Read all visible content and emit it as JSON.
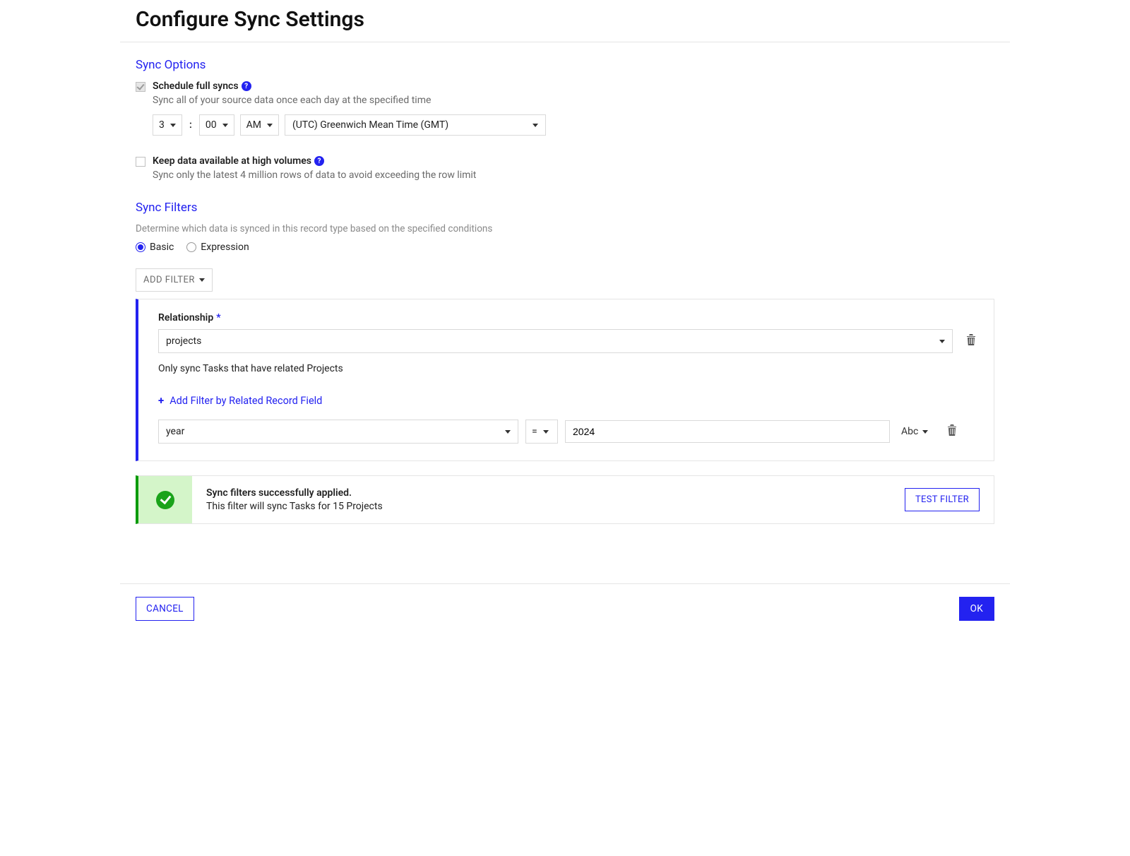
{
  "header": {
    "title": "Configure Sync Settings"
  },
  "sections": {
    "sync_options": {
      "title": "Sync Options",
      "schedule": {
        "label": "Schedule full syncs",
        "desc": "Sync all of your source data once each day at the specified time",
        "hour": "3",
        "minute": "00",
        "ampm": "AM",
        "timezone": "(UTC) Greenwich Mean Time (GMT)",
        "help": "?"
      },
      "high_volume": {
        "label": "Keep data available at high volumes",
        "desc": "Sync only the latest 4 million rows of data to avoid exceeding the row limit",
        "help": "?"
      }
    },
    "sync_filters": {
      "title": "Sync Filters",
      "desc": "Determine which data is synced in this record type based on the specified conditions",
      "radio": {
        "basic": "Basic",
        "expression": "Expression"
      },
      "add_filter": "ADD FILTER",
      "filter": {
        "relationship_label": "Relationship",
        "relationship_value": "projects",
        "explain": "Only sync Tasks that have related Projects",
        "add_related": "Add Filter by Related Record Field",
        "field_value": "year",
        "operator": "=",
        "value": "2024",
        "abc": "Abc"
      },
      "success": {
        "title": "Sync filters successfully applied.",
        "sub": "This filter will sync Tasks for 15 Projects",
        "test_btn": "TEST FILTER"
      }
    }
  },
  "footer": {
    "cancel": "CANCEL",
    "ok": "OK"
  }
}
